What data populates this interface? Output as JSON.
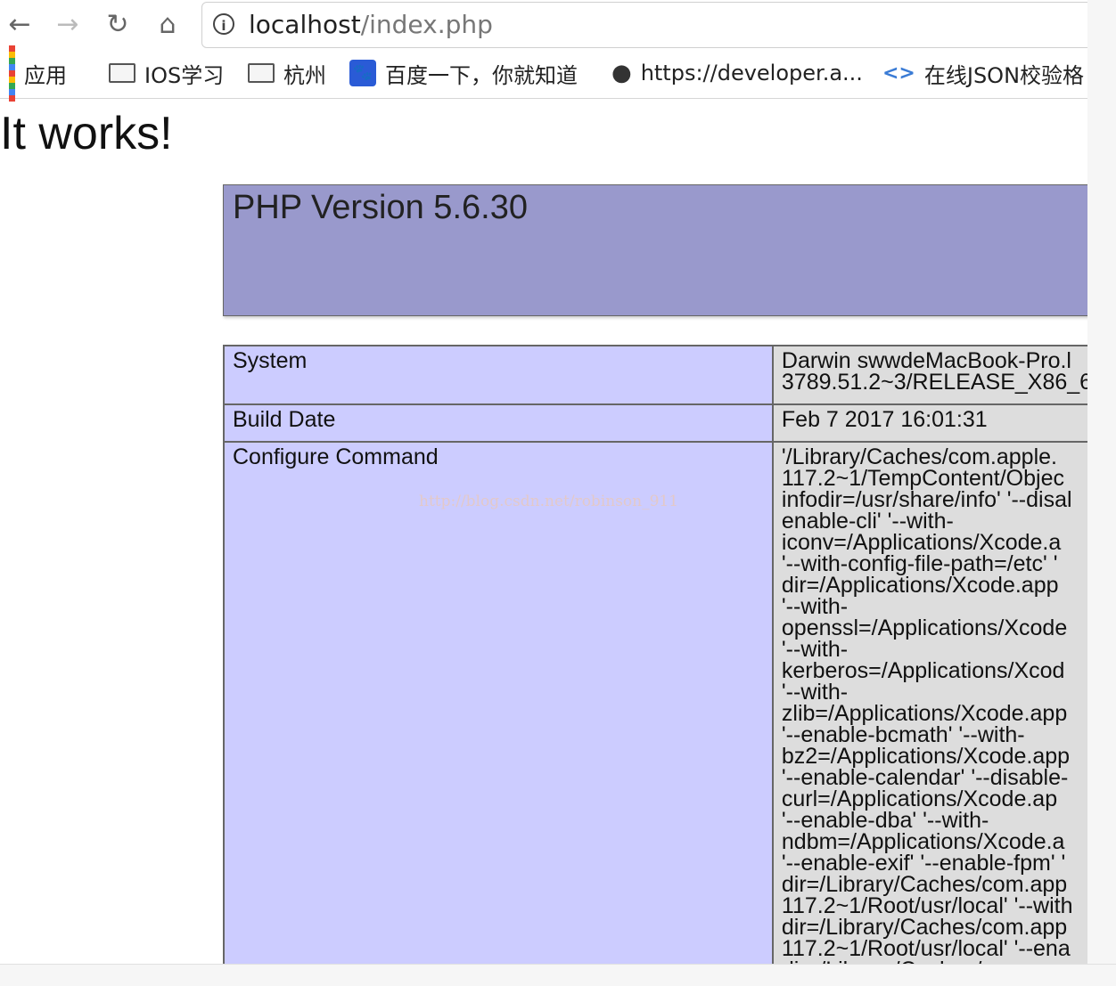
{
  "browser": {
    "url_host": "localhost",
    "url_path": "/index.php",
    "info_icon": "i",
    "nav_icons": {
      "back": "←",
      "forward": "→",
      "reload": "↻",
      "home": "⌂"
    },
    "bookmarks": [
      {
        "label": "应用",
        "icon": "apps-grid-icon"
      },
      {
        "label": "IOS学习",
        "icon": "folder-icon"
      },
      {
        "label": "杭州",
        "icon": "folder-icon"
      },
      {
        "label": "百度一下，你就知道",
        "icon": "baidu-paw-icon"
      },
      {
        "label": "https://developer.a...",
        "icon": "apple-icon"
      },
      {
        "label": "在线JSON校验格",
        "icon": "json-icon"
      }
    ]
  },
  "page": {
    "heading": "It works!",
    "watermark": "http://blog.csdn.net/robinson_911",
    "php_title": "PHP Version 5.6.30",
    "rows": [
      {
        "key": "System",
        "value": "Darwin swwdeMacBook-Pro.l\n3789.51.2~3/RELEASE_X86_64"
      },
      {
        "key": "Build Date",
        "value": "Feb 7 2017 16:01:31"
      },
      {
        "key": "Configure Command",
        "value": "'/Library/Caches/com.apple.\n117.2~1/TempContent/Objec\ninfodir=/usr/share/info' '--disal\nenable-cli' '--with-\niconv=/Applications/Xcode.a\n'--with-config-file-path=/etc' '\ndir=/Applications/Xcode.app\n'--with-\nopenssl=/Applications/Xcode\n'--with-\nkerberos=/Applications/Xcod\n'--with-\nzlib=/Applications/Xcode.app\n'--enable-bcmath' '--with-\nbz2=/Applications/Xcode.app\n'--enable-calendar' '--disable-\ncurl=/Applications/Xcode.ap\n'--enable-dba' '--with-\nndbm=/Applications/Xcode.a\n'--enable-exif' '--enable-fpm' '\ndir=/Library/Caches/com.app\n117.2~1/Root/usr/local' '--with\ndir=/Library/Caches/com.app\n117.2~1/Root/usr/local' '--ena\ndir=/Library/Caches/com.app"
      }
    ]
  },
  "colors": {
    "header_bg": "#9999cc",
    "key_bg": "#ccccff",
    "value_bg": "#dddddd"
  }
}
